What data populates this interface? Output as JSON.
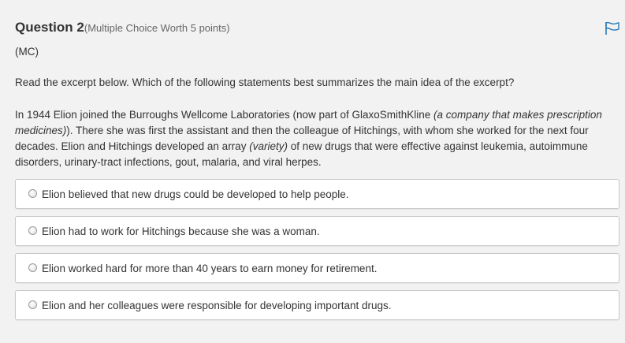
{
  "question": {
    "title": "Question 2",
    "points": "(Multiple Choice Worth 5 points)",
    "type_tag": "(MC)",
    "prompt": "Read the excerpt below. Which of the following statements best summarizes the main idea of the excerpt?",
    "excerpt": {
      "part1": "In 1944 Elion joined the Burroughs Wellcome Laboratories (now part of GlaxoSmithKline ",
      "part2_italic": "(a company that makes prescription medicines)",
      "part3": "). There she was first the assistant and then the colleague of Hitchings, with whom she worked for the next four decades. Elion and Hitchings developed an array ",
      "part4_italic": "(variety)",
      "part5": " of new drugs that were effective against leukemia, autoimmune disorders, urinary-tract infections, gout, malaria, and viral herpes."
    },
    "flag_icon": "flag-icon",
    "flag_color": "#2a7ab8"
  },
  "options": [
    {
      "label": "Elion believed that new drugs could be developed to help people.",
      "selected": false
    },
    {
      "label": "Elion had to work for Hitchings because she was a woman.",
      "selected": false
    },
    {
      "label": "Elion worked hard for more than 40 years to earn money for retirement.",
      "selected": false
    },
    {
      "label": "Elion and her colleagues were responsible for developing important drugs.",
      "selected": false
    }
  ]
}
